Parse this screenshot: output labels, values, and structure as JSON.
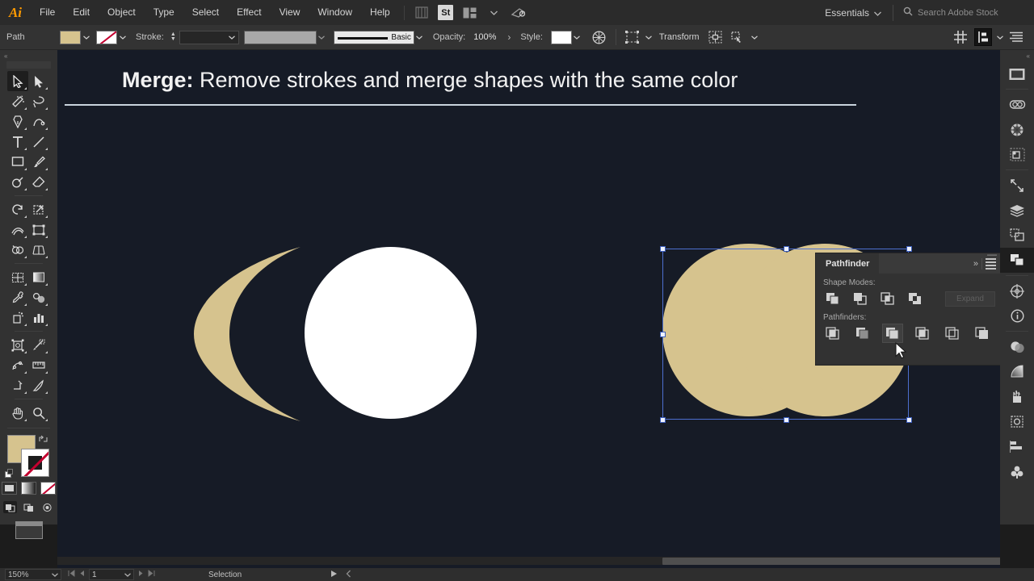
{
  "app": {
    "name": "Adobe Illustrator",
    "logo": "Ai"
  },
  "menubar": {
    "items": [
      "File",
      "Edit",
      "Object",
      "Type",
      "Select",
      "Effect",
      "View",
      "Window",
      "Help"
    ],
    "icons": [
      "bridge-icon",
      "adobe-stock-icon",
      "arrange-documents-icon",
      "switch-workspace-icon"
    ],
    "stock_badge": "St",
    "workspace": "Essentials",
    "workspace_caret": "∨",
    "search_placeholder": "Search Adobe Stock",
    "search_icon": "magnifier-icon"
  },
  "controlbar": {
    "object_label": "Path",
    "fill_color": "#d6c38e",
    "stroke_color": "none",
    "stroke_label": "Stroke:",
    "stroke_weight": "",
    "stroke_profile": "",
    "brush_label": "Basic",
    "opacity_label": "Opacity:",
    "opacity_value": "100%",
    "opacity_arrow": "›",
    "style_label": "Style:",
    "style_swatch": "#ffffff",
    "recolor_icon": "recolor-artwork-icon",
    "select_similar_icon": "select-similar-icon",
    "transform_label": "Transform",
    "isolate_icon": "isolate-group-icon",
    "arrange_icon": "arrange-objects-icon",
    "align_grid_icon": "align-grid-icon",
    "distribute_icon": "distribute-icon",
    "options_icon": "panel-options-icon"
  },
  "toolbar": {
    "tools": [
      {
        "name": "selection-tool",
        "glyph": "selection",
        "selected": true
      },
      {
        "name": "direct-selection-tool",
        "glyph": "direct-selection",
        "selected": false
      },
      {
        "name": "magic-wand-tool",
        "glyph": "magic-wand",
        "selected": false
      },
      {
        "name": "lasso-tool",
        "glyph": "lasso",
        "selected": false
      },
      {
        "name": "pen-tool",
        "glyph": "pen",
        "selected": false
      },
      {
        "name": "curvature-tool",
        "glyph": "curvature",
        "selected": false
      },
      {
        "name": "type-tool",
        "glyph": "type",
        "selected": false
      },
      {
        "name": "line-segment-tool",
        "glyph": "line",
        "selected": false
      },
      {
        "name": "rectangle-tool",
        "glyph": "rectangle",
        "selected": false
      },
      {
        "name": "paintbrush-tool",
        "glyph": "paintbrush",
        "selected": false
      },
      {
        "name": "shaper-tool",
        "glyph": "shaper",
        "selected": false
      },
      {
        "name": "eraser-tool",
        "glyph": "eraser",
        "selected": false
      },
      {
        "name": "rotate-tool",
        "glyph": "rotate",
        "selected": false
      },
      {
        "name": "scale-tool",
        "glyph": "scale",
        "selected": false
      },
      {
        "name": "width-tool",
        "glyph": "width",
        "selected": false
      },
      {
        "name": "free-transform-tool",
        "glyph": "free-transform",
        "selected": false
      },
      {
        "name": "shape-builder-tool",
        "glyph": "shape-builder",
        "selected": false
      },
      {
        "name": "perspective-grid-tool",
        "glyph": "perspective-grid",
        "selected": false
      },
      {
        "name": "mesh-tool",
        "glyph": "mesh",
        "selected": false
      },
      {
        "name": "gradient-tool",
        "glyph": "gradient",
        "selected": false
      },
      {
        "name": "eyedropper-tool",
        "glyph": "eyedropper",
        "selected": false
      },
      {
        "name": "blend-tool",
        "glyph": "blend",
        "selected": false
      },
      {
        "name": "symbol-sprayer-tool",
        "glyph": "symbol-sprayer",
        "selected": false
      },
      {
        "name": "column-graph-tool",
        "glyph": "column-graph",
        "selected": false
      },
      {
        "name": "artboard-tool",
        "glyph": "artboard",
        "selected": false
      },
      {
        "name": "slice-tool",
        "glyph": "slice",
        "selected": false
      },
      {
        "name": "puppet-warp-tool",
        "glyph": "puppet-warp",
        "selected": false
      },
      {
        "name": "measure-tool",
        "glyph": "measure",
        "selected": false
      },
      {
        "name": "scissors-tool",
        "glyph": "scissors",
        "selected": false
      },
      {
        "name": "knife-tool",
        "glyph": "knife",
        "selected": false
      },
      {
        "name": "hand-tool",
        "glyph": "hand",
        "selected": false
      },
      {
        "name": "zoom-tool",
        "glyph": "zoom",
        "selected": false
      }
    ],
    "fill_swatch": "#d6c38e",
    "stroke_swatch": "none",
    "mode_buttons": [
      "color-mode-button",
      "gradient-mode-button",
      "none-mode-button"
    ],
    "draw_modes": [
      "draw-normal-button",
      "draw-behind-button",
      "draw-inside-button"
    ],
    "screen_mode": "change-screen-mode-button"
  },
  "canvas": {
    "title_bold": "Merge:",
    "title_rest": " Remove strokes and merge shapes with the same color",
    "shape_fill": "#d6c38e",
    "circle_fill": "#ffffff",
    "background": "#161b26",
    "selection_color": "#4d6fcf"
  },
  "pathfinder": {
    "title": "Pathfinder",
    "collapse_icon": "double-chevron-icon",
    "menu_icon": "panel-menu-icon",
    "close_icon": "panel-close-icon",
    "shape_modes_label": "Shape Modes:",
    "shape_modes": [
      {
        "name": "unite-button",
        "label": "Unite"
      },
      {
        "name": "minus-front-button",
        "label": "Minus Front"
      },
      {
        "name": "intersect-button",
        "label": "Intersect"
      },
      {
        "name": "exclude-button",
        "label": "Exclude"
      }
    ],
    "expand_label": "Expand",
    "expand_enabled": false,
    "pathfinders_label": "Pathfinders:",
    "pathfinders": [
      {
        "name": "divide-button",
        "label": "Divide",
        "highlighted": false
      },
      {
        "name": "trim-button",
        "label": "Trim",
        "highlighted": false
      },
      {
        "name": "merge-button",
        "label": "Merge",
        "highlighted": true
      },
      {
        "name": "crop-button",
        "label": "Crop",
        "highlighted": false
      },
      {
        "name": "outline-button",
        "label": "Outline",
        "highlighted": false
      },
      {
        "name": "minus-back-button",
        "label": "Minus Back",
        "highlighted": false
      }
    ]
  },
  "dock": {
    "items": [
      {
        "name": "artboards-panel-icon",
        "active": false
      },
      {
        "name": "cc-libraries-panel-icon",
        "active": false
      },
      {
        "name": "color-panel-icon",
        "active": false
      },
      {
        "name": "properties-panel-icon",
        "active": false
      },
      {
        "name": "export-panel-icon",
        "active": false
      },
      {
        "name": "layers-panel-icon",
        "active": false
      },
      {
        "name": "transform-panel-icon",
        "active": false
      },
      {
        "name": "pathfinder-panel-icon",
        "active": true
      },
      {
        "name": "align-panel-icon",
        "active": false
      },
      {
        "name": "info-panel-icon",
        "active": false
      },
      {
        "name": "transparency-panel-icon",
        "active": false
      },
      {
        "name": "gradient-panel-icon",
        "active": false
      },
      {
        "name": "brushes-panel-icon",
        "active": false
      },
      {
        "name": "symbols-panel-icon",
        "active": false
      },
      {
        "name": "paragraph-panel-icon",
        "active": false
      },
      {
        "name": "swatches-panel-icon",
        "active": false
      }
    ]
  },
  "statusbar": {
    "zoom": "150%",
    "zoom_caret": "∨",
    "page": "1",
    "page_caret": "∨",
    "first_icon": "first-artboard-icon",
    "prev_icon": "previous-artboard-icon",
    "next_icon": "next-artboard-icon",
    "last_icon": "last-artboard-icon",
    "current_tool": "Selection",
    "play_icon": "play-icon",
    "back_icon": "back-icon"
  }
}
